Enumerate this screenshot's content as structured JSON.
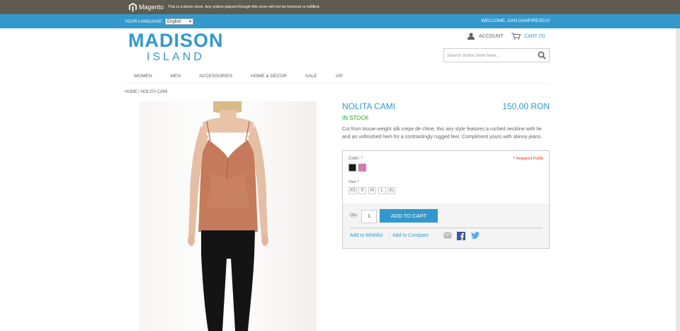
{
  "demo_bar": {
    "logo_text": "Magento",
    "notice": "This is a demo store. Any orders placed through this store will not be honored or fulfilled."
  },
  "header_bar": {
    "language_label": "YOUR LANGUAGE:",
    "language_value": "English",
    "welcome": "WELCOME, DAN DANFIRESCU!"
  },
  "logo": {
    "line1": "MADISON",
    "line2": "ISLAND"
  },
  "account": {
    "account_label": "ACCOUNT",
    "cart_label": "CART (5)"
  },
  "search": {
    "placeholder": "Search entire store here..."
  },
  "nav": {
    "items": [
      "WOMEN",
      "MEN",
      "ACCESSORIES",
      "HOME & DECOR",
      "SALE",
      "VIP"
    ]
  },
  "breadcrumb": {
    "home": "HOME",
    "sep": "/",
    "current": "NOLITA CAMI"
  },
  "product": {
    "name": "NOLITA CAMI",
    "price": "150,00 RON",
    "stock": "IN STOCK",
    "description": "Cut from tissue-weight silk crepe de chine, this airy style features a ruched neckline with tie and an unfinished hem for a contrastingly rugged feel. Compliment yours with skinny jeans.",
    "color_label": "Color:",
    "required_star": "*",
    "required_fields": "* Required Fields",
    "colors": [
      "#1a1a1a",
      "#e86fb8"
    ],
    "size_label": "Size",
    "sizes": [
      "XS",
      "S",
      "M",
      "L",
      "XL"
    ],
    "qty_label": "Qty:",
    "qty_value": "1",
    "add_to_cart": "ADD TO CART",
    "wishlist": "Add to Wishlist",
    "separator": "|",
    "compare": "Add to Compare"
  },
  "colors": {
    "accent": "#3399cc",
    "stock": "#11b400",
    "demo_bar": "#5f5b4f",
    "required": "#df280a"
  }
}
